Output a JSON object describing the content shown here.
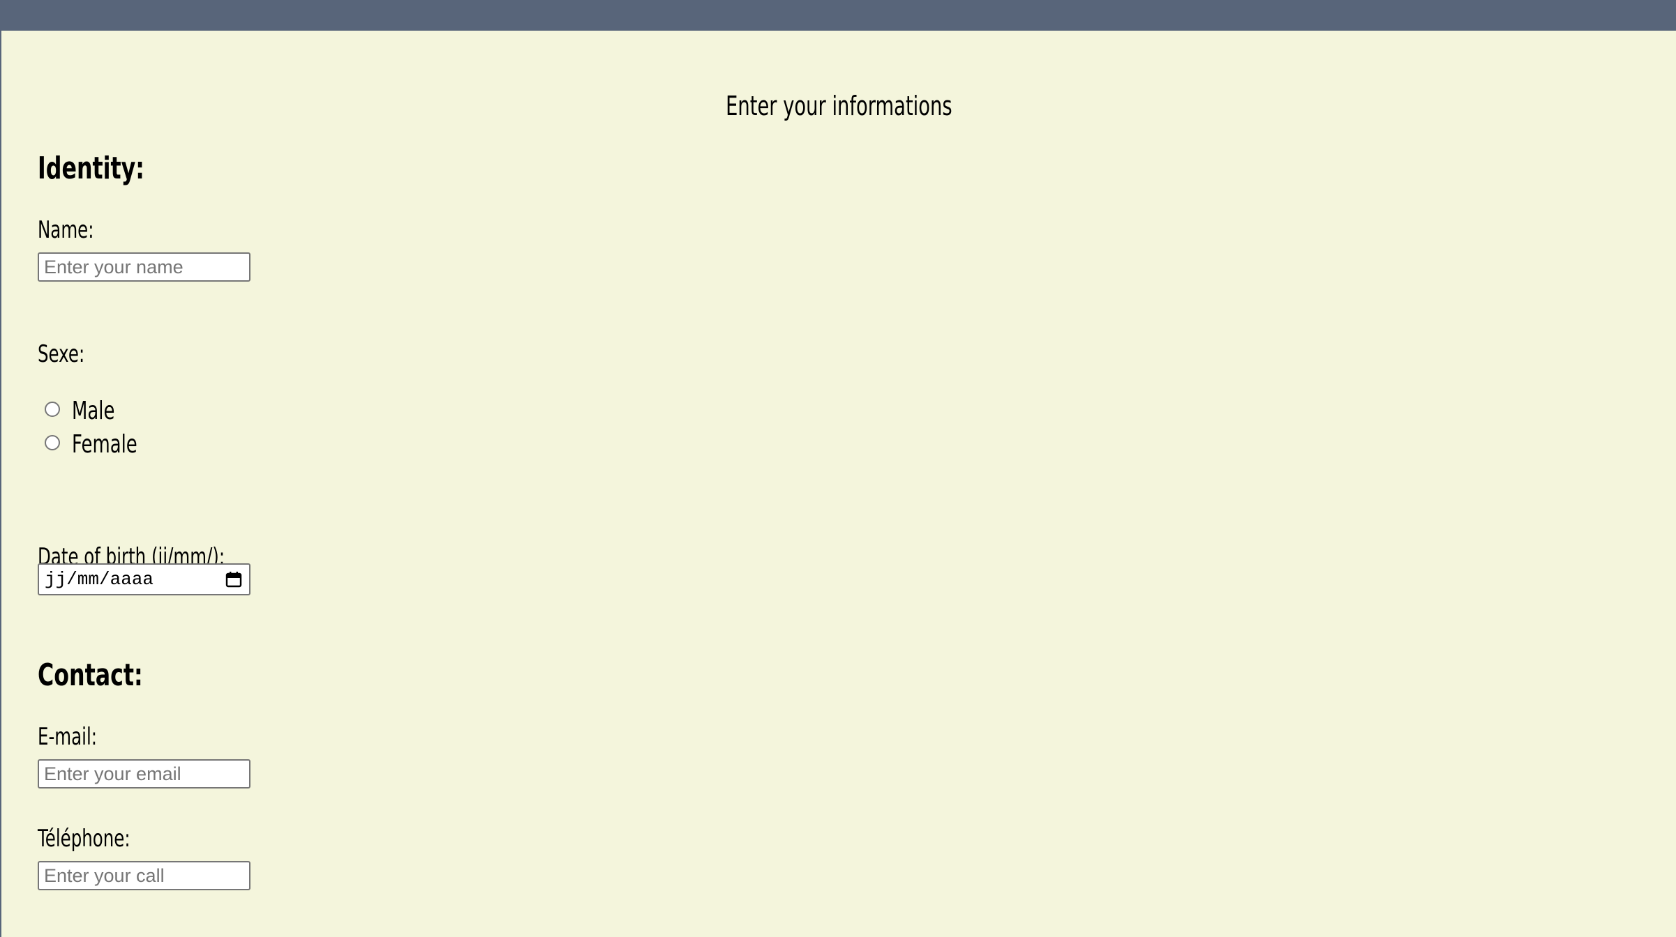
{
  "page": {
    "title": "Enter your informations"
  },
  "identity": {
    "section_title": "Identity:",
    "name_label": "Name:",
    "name_placeholder": "Enter your name",
    "sex_label": "Sexe:",
    "sex_options": [
      {
        "label": "Male",
        "checked": false
      },
      {
        "label": "Female",
        "checked": false
      }
    ],
    "dob_label": "Date of birth (jj/mm/):",
    "dob_placeholder": "jj/mm/aaaa"
  },
  "contact": {
    "section_title": "Contact:",
    "email_label": "E-mail:",
    "email_placeholder": "Enter your email",
    "phone_label": "Téléphone:",
    "phone_placeholder": "Enter your call"
  },
  "icons": {
    "date_picker": "calendar-icon"
  },
  "colors": {
    "background": "#f4f5dc",
    "top_bar": "#58657a"
  }
}
